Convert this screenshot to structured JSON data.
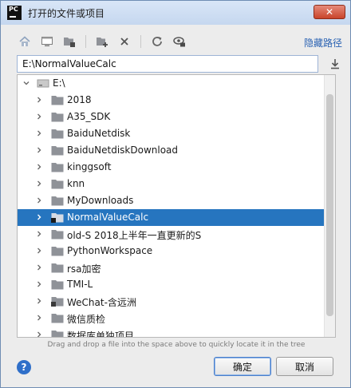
{
  "window": {
    "title": "打开的文件或项目",
    "app_icon_text": "PC",
    "close_glyph": "✕"
  },
  "toolbar": {
    "icons": [
      "home-icon",
      "desktop-icon",
      "project-folder-icon",
      "new-folder-icon",
      "delete-icon",
      "refresh-icon",
      "show-hidden-icon"
    ],
    "hide_path_label": "隐藏路径"
  },
  "path": {
    "value": "E:\\NormalValueCalc"
  },
  "tree": {
    "root": "E:\\",
    "items": [
      {
        "label": "2018",
        "selected": false,
        "special": false
      },
      {
        "label": "A35_SDK",
        "selected": false,
        "special": false
      },
      {
        "label": "BaiduNetdisk",
        "selected": false,
        "special": false
      },
      {
        "label": "BaiduNetdiskDownload",
        "selected": false,
        "special": false
      },
      {
        "label": "kinggsoft",
        "selected": false,
        "special": false
      },
      {
        "label": "knn",
        "selected": false,
        "special": false
      },
      {
        "label": "MyDownloads",
        "selected": false,
        "special": false
      },
      {
        "label": "NormalValueCalc",
        "selected": true,
        "special": true
      },
      {
        "label": "old-S 2018上半年一直更新的S",
        "selected": false,
        "special": false
      },
      {
        "label": "PythonWorkspace",
        "selected": false,
        "special": false
      },
      {
        "label": "rsa加密",
        "selected": false,
        "special": false
      },
      {
        "label": "TMI-L",
        "selected": false,
        "special": false
      },
      {
        "label": "WeChat-含远洲",
        "selected": false,
        "special": true
      },
      {
        "label": "微信质检",
        "selected": false,
        "special": false
      },
      {
        "label": "数据库单独项目",
        "selected": false,
        "special": false
      }
    ]
  },
  "hint": "Drag and drop a file into the space above to quickly locate it in the tree",
  "buttons": {
    "help": "?",
    "ok": "确定",
    "cancel": "取消"
  },
  "colors": {
    "selection": "#2675bf",
    "link": "#2b63b3",
    "folder": "#8f9298"
  }
}
